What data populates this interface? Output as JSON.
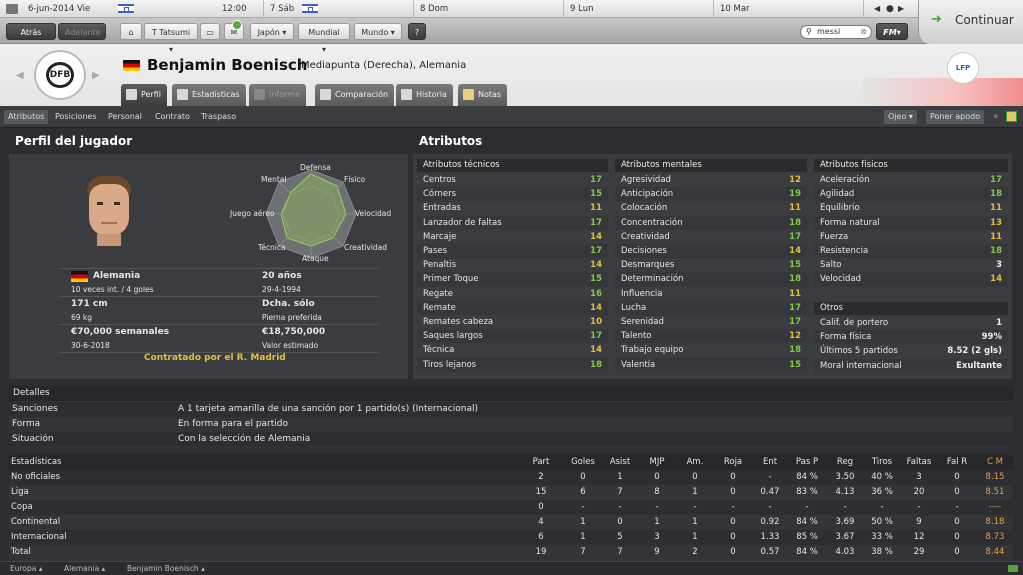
{
  "topbar": {
    "date": "6-jun-2014 Vie",
    "time": "12:00",
    "days": [
      "7 Sáb",
      "8 Dom",
      "9 Lun",
      "10 Mar"
    ],
    "continue_label": "Continuar"
  },
  "toolbar": {
    "back": "Atrás",
    "forward": "Adelante",
    "manager": "T Tatsumi",
    "nation": "Japón",
    "world": "Mundial",
    "globe": "Mundo",
    "help": "?",
    "search_value": "messi",
    "fm": "FM"
  },
  "player": {
    "name": "Benjamin Boenisch",
    "role": "Mediapunta (Derecha), Alemania"
  },
  "tabs": [
    "Perfil",
    "Estadísticas",
    "Informe",
    "Comparación",
    "Historia",
    "Notas"
  ],
  "subnav": [
    "Atributos",
    "Posiciones",
    "Personal",
    "Contrato",
    "Traspaso"
  ],
  "subnav_right": {
    "scout": "Ojeo",
    "support": "Poner apodo"
  },
  "profile": {
    "title": "Perfil del jugador",
    "radar_labels": {
      "top": "Defensa",
      "tl": "Mental",
      "tr": "Físico",
      "l": "Juego aéreo",
      "r": "Velocidad",
      "bl": "Técnica",
      "br": "Creatividad",
      "bottom": "Ataque"
    },
    "nation": "Alemania",
    "caps": "10 veces int. / 4 goles",
    "age": "20 años",
    "dob": "29-4-1994",
    "height": "171 cm",
    "weight": "69 kg",
    "foot": "Dcha. sólo",
    "foot_label": "Pierna preferida",
    "wage": "€70,000 semanales",
    "contract_end": "30-6-2018",
    "value": "€18,750,000",
    "value_label": "Valor estimado",
    "contracted": "Contratado por el R. Madrid"
  },
  "attributes": {
    "title": "Atributos",
    "technical_title": "Atributos técnicos",
    "technical": [
      {
        "n": "Centros",
        "v": "17"
      },
      {
        "n": "Córners",
        "v": "15"
      },
      {
        "n": "Entradas",
        "v": "11"
      },
      {
        "n": "Lanzador de faltas",
        "v": "17"
      },
      {
        "n": "Marcaje",
        "v": "14"
      },
      {
        "n": "Pases",
        "v": "17"
      },
      {
        "n": "Penaltis",
        "v": "14"
      },
      {
        "n": "Primer Toque",
        "v": "15"
      },
      {
        "n": "Regate",
        "v": "16"
      },
      {
        "n": "Remate",
        "v": "14"
      },
      {
        "n": "Remates cabeza",
        "v": "10"
      },
      {
        "n": "Saques largos",
        "v": "17"
      },
      {
        "n": "Técnica",
        "v": "14"
      },
      {
        "n": "Tiros lejanos",
        "v": "18"
      }
    ],
    "mental_title": "Atributos mentales",
    "mental": [
      {
        "n": "Agresividad",
        "v": "12"
      },
      {
        "n": "Anticipación",
        "v": "19"
      },
      {
        "n": "Colocación",
        "v": "11"
      },
      {
        "n": "Concentración",
        "v": "18"
      },
      {
        "n": "Creatividad",
        "v": "17"
      },
      {
        "n": "Decisiones",
        "v": "14"
      },
      {
        "n": "Desmarques",
        "v": "15"
      },
      {
        "n": "Determinación",
        "v": "18"
      },
      {
        "n": "Influencia",
        "v": "11"
      },
      {
        "n": "Lucha",
        "v": "17"
      },
      {
        "n": "Serenidad",
        "v": "17"
      },
      {
        "n": "Talento",
        "v": "12"
      },
      {
        "n": "Trabajo equipo",
        "v": "18"
      },
      {
        "n": "Valentía",
        "v": "15"
      }
    ],
    "physical_title": "Atributos físicos",
    "physical": [
      {
        "n": "Aceleración",
        "v": "17"
      },
      {
        "n": "Agilidad",
        "v": "18"
      },
      {
        "n": "Equilibrio",
        "v": "11"
      },
      {
        "n": "Forma natural",
        "v": "13"
      },
      {
        "n": "Fuerza",
        "v": "11"
      },
      {
        "n": "Resistencia",
        "v": "18"
      },
      {
        "n": "Salto",
        "v": "3"
      },
      {
        "n": "Velocidad",
        "v": "14"
      }
    ],
    "other_title": "Otros",
    "other": [
      {
        "n": "Calif. de portero",
        "v": "1"
      },
      {
        "n": "Forma física",
        "v": "99%"
      },
      {
        "n": "Últimos 5 partidos",
        "v": "8.52 (2 gls)"
      },
      {
        "n": "Moral internacional",
        "v": "Exultante"
      }
    ]
  },
  "details": {
    "title": "Detalles",
    "rows": [
      {
        "k": "Sanciones",
        "v": "A 1 tarjeta amarilla de una sanción por 1 partido(s) (Internacional)"
      },
      {
        "k": "Forma",
        "v": "En forma para el partido"
      },
      {
        "k": "Situación",
        "v": "Con la selección de Alemania"
      }
    ]
  },
  "stats": {
    "title": "Estadísticas",
    "headers": [
      "Part",
      "Goles",
      "Asist",
      "MJP",
      "Am.",
      "Roja",
      "Ent",
      "Pas P",
      "Reg",
      "Tiros",
      "Faltas",
      "Fal R",
      "C M"
    ],
    "rows": [
      {
        "name": "No oficiales",
        "vals": [
          "2",
          "0",
          "1",
          "0",
          "0",
          "0",
          "-",
          "84 %",
          "3.50",
          "40 %",
          "3",
          "0",
          "8.15"
        ]
      },
      {
        "name": "Liga",
        "vals": [
          "15",
          "6",
          "7",
          "8",
          "1",
          "0",
          "0.47",
          "83 %",
          "4.13",
          "36 %",
          "20",
          "0",
          "8.51"
        ]
      },
      {
        "name": "Copa",
        "vals": [
          "0",
          "-",
          "-",
          "-",
          "-",
          "-",
          "-",
          "-",
          "-",
          "-",
          "-",
          "-",
          "----"
        ]
      },
      {
        "name": "Continental",
        "vals": [
          "4",
          "1",
          "0",
          "1",
          "1",
          "0",
          "0.92",
          "84 %",
          "3.69",
          "50 %",
          "9",
          "0",
          "8.18"
        ]
      },
      {
        "name": "Internacional",
        "vals": [
          "6",
          "1",
          "5",
          "3",
          "1",
          "0",
          "1.33",
          "85 %",
          "3.67",
          "33 %",
          "12",
          "0",
          "8.73"
        ]
      },
      {
        "name": "Total",
        "vals": [
          "19",
          "7",
          "7",
          "9",
          "2",
          "0",
          "0.57",
          "84 %",
          "4.03",
          "38 %",
          "29",
          "0",
          "8.44"
        ]
      }
    ]
  },
  "footer": [
    "Europa",
    "Alemania",
    "Benjamin Boenisch"
  ]
}
